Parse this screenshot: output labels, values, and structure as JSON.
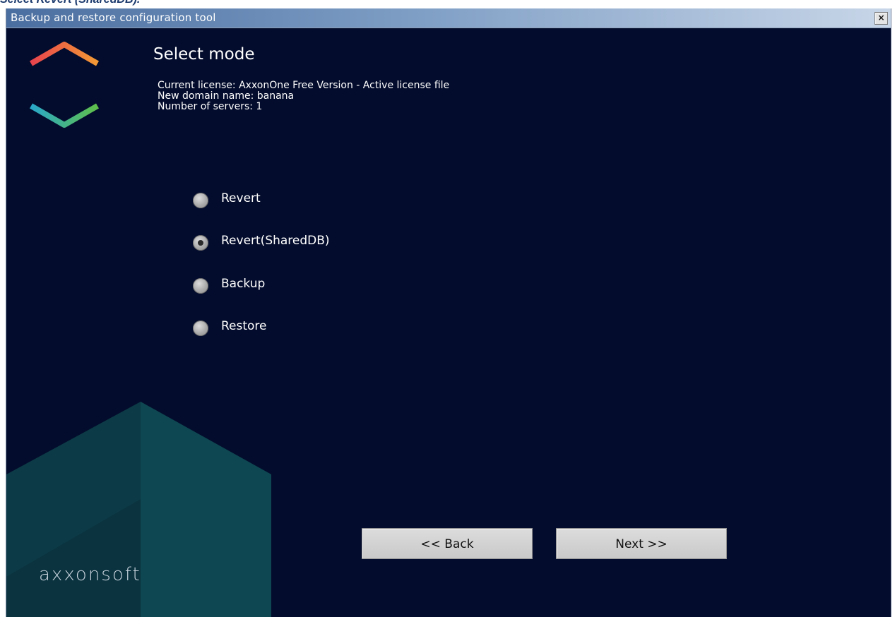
{
  "caption": "Select Revert (SharedDB).",
  "window": {
    "title": "Backup and restore configuration tool",
    "close_label": "×"
  },
  "header": {
    "title": "Select mode",
    "license_line": "Current license: AxxonOne Free Version - Active license file",
    "domain_line": "New domain name: banana",
    "servers_line": "Number of servers: 1"
  },
  "modes": {
    "selected": "Revert(SharedDB)",
    "options": [
      {
        "label": "Revert",
        "checked": false
      },
      {
        "label": "Revert(SharedDB)",
        "checked": true
      },
      {
        "label": "Backup",
        "checked": false
      },
      {
        "label": "Restore",
        "checked": false
      }
    ]
  },
  "buttons": {
    "back": "<< Back",
    "next": "Next >>"
  },
  "brand": {
    "logo_text": "axxonsoft"
  },
  "colors": {
    "background": "#030c2c",
    "titlebar": "#6f8fba",
    "button": "#d2d2d2",
    "cube": "#0c3a46"
  },
  "icons": {
    "app_logo": "hexagon-logo-icon",
    "close": "close-icon",
    "background": "hexagon-cube-graphic"
  }
}
